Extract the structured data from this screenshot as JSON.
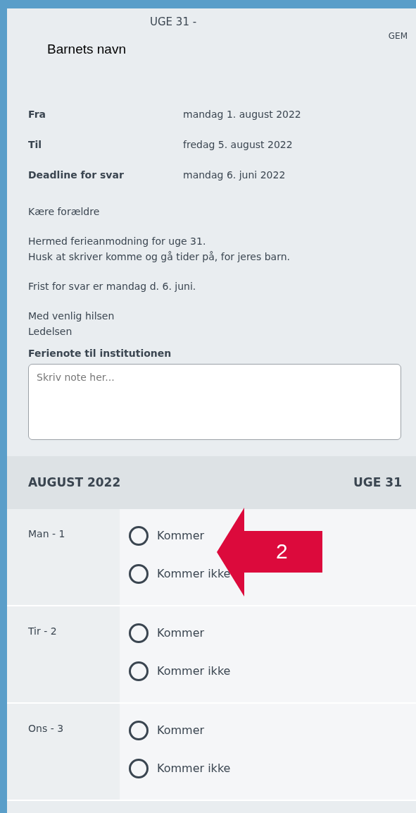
{
  "header": {
    "title": "UGE 31 -",
    "save_button": "GEM",
    "child_name": "Barnets navn"
  },
  "details": [
    {
      "label": "Fra",
      "value": "mandag 1. august 2022"
    },
    {
      "label": "Til",
      "value": "fredag 5. august 2022"
    },
    {
      "label": "Deadline for svar",
      "value": "mandag 6. juni 2022"
    }
  ],
  "message": [
    "Kære forældre",
    "Hermed ferieanmodning for uge 31.\nHusk at skriver komme og gå tider på, for jeres barn.",
    "Frist for svar er mandag d. 6. juni.",
    "Med venlig hilsen\nLedelsen"
  ],
  "note": {
    "label": "Ferienote til institutionen",
    "placeholder": "Skriv note her..."
  },
  "calendar": {
    "month": "AUGUST 2022",
    "week": "UGE 31",
    "days": [
      {
        "label": "Man - 1",
        "options": [
          {
            "label": "Kommer",
            "selected": false
          },
          {
            "label": "Kommer ikke",
            "selected": false
          }
        ]
      },
      {
        "label": "Tir - 2",
        "options": [
          {
            "label": "Kommer",
            "selected": false
          },
          {
            "label": "Kommer ikke",
            "selected": false
          }
        ]
      },
      {
        "label": "Ons - 3",
        "options": [
          {
            "label": "Kommer",
            "selected": false
          },
          {
            "label": "Kommer ikke",
            "selected": false
          }
        ]
      }
    ]
  },
  "annotation": {
    "kind": "arrow",
    "label": "2"
  }
}
